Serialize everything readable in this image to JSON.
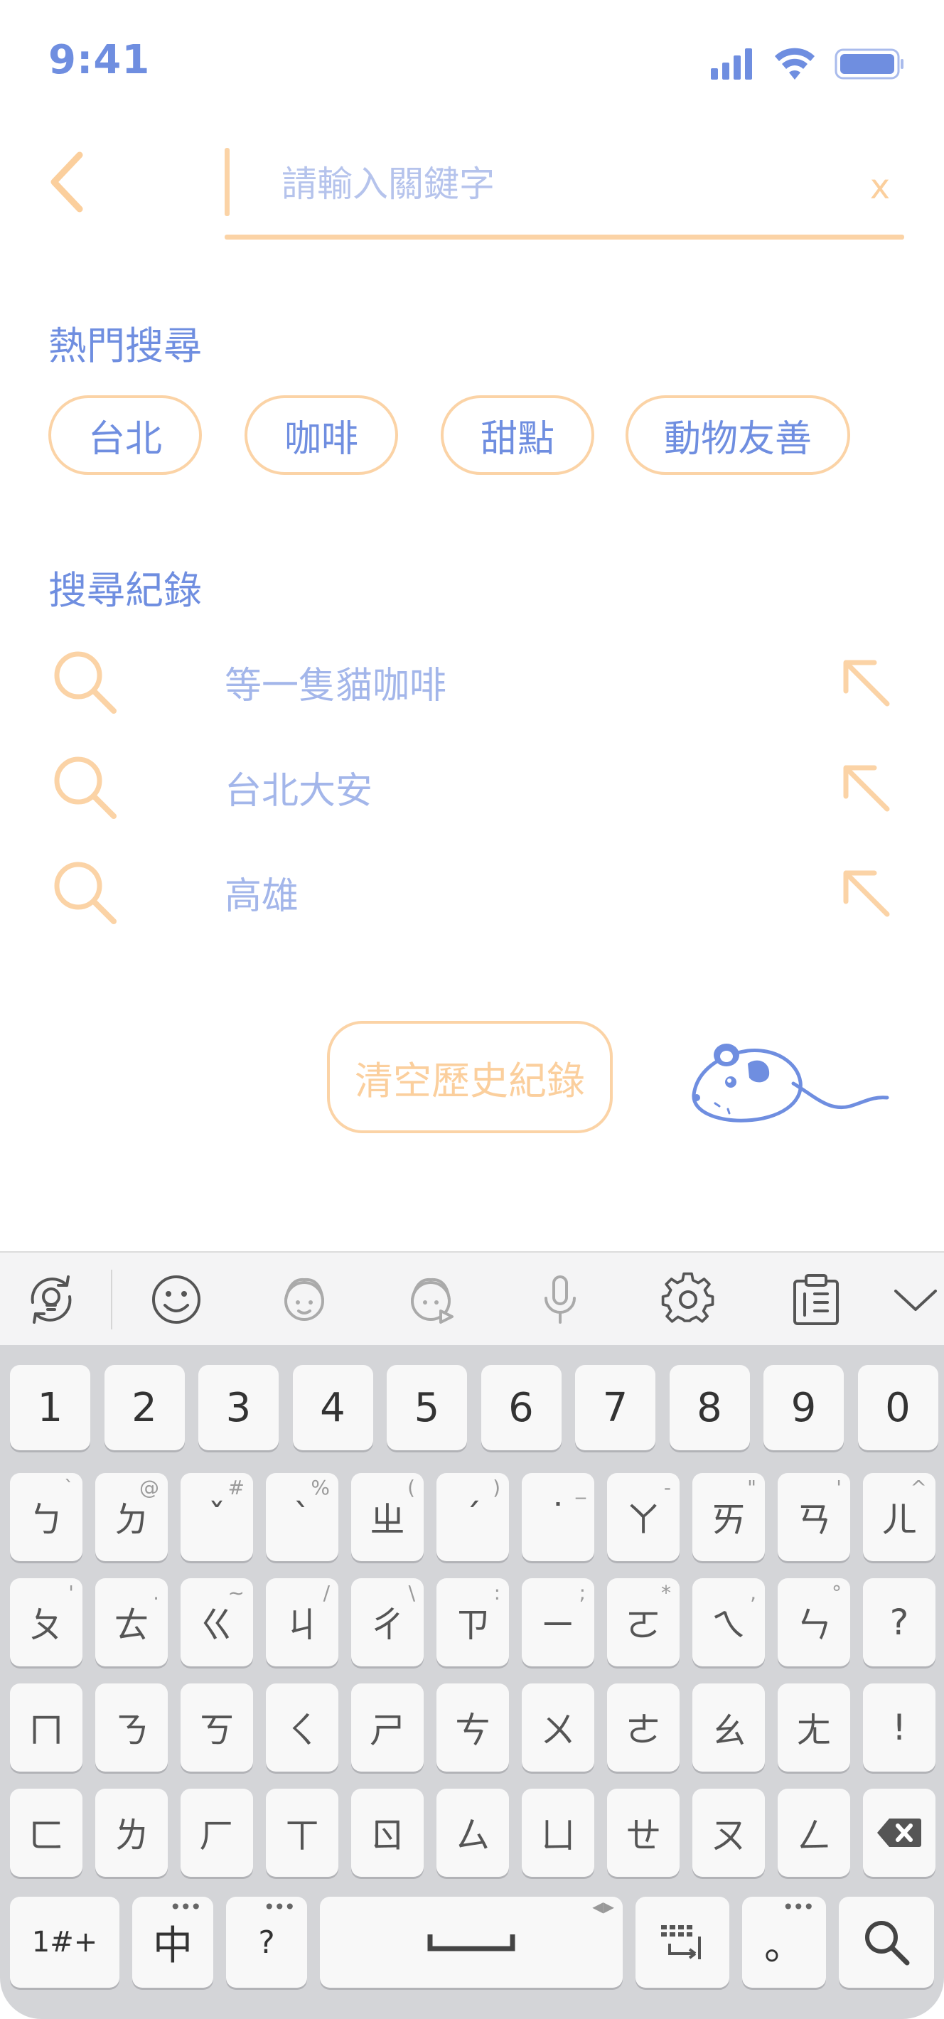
{
  "status_bar": {
    "time": "9:41"
  },
  "search": {
    "placeholder": "請輸入關鍵字",
    "value": "",
    "clear_label": "x"
  },
  "popular": {
    "title": "熱門搜尋",
    "chips": [
      "台北",
      "咖啡",
      "甜點",
      "動物友善"
    ]
  },
  "history": {
    "title": "搜尋紀錄",
    "items": [
      "等一隻貓咖啡",
      "台北大安",
      "高雄"
    ],
    "clear_label": "清空歷史紀錄"
  },
  "colors": {
    "accent_blue": "#6f8ee0",
    "light_blue": "#a3b6ea",
    "accent_orange": "#fbd3a6"
  },
  "keyboard": {
    "toolbar_icons": [
      "lightbulb-sync-icon",
      "emoji-icon",
      "face-icon",
      "face-play-icon",
      "microphone-icon",
      "gear-icon",
      "clipboard-icon",
      "chevron-down-icon"
    ],
    "numbers": [
      "1",
      "2",
      "3",
      "4",
      "5",
      "6",
      "7",
      "8",
      "9",
      "0"
    ],
    "row1": [
      {
        "k": "ㄅ",
        "s": "`"
      },
      {
        "k": "ㄉ",
        "s": "@"
      },
      {
        "k": "ˇ",
        "s": "#"
      },
      {
        "k": "ˋ",
        "s": "%"
      },
      {
        "k": "ㄓ",
        "s": "("
      },
      {
        "k": "ˊ",
        "s": ")"
      },
      {
        "k": "˙",
        "s": "_"
      },
      {
        "k": "ㄚ",
        "s": "-"
      },
      {
        "k": "ㄞ",
        "s": "\""
      },
      {
        "k": "ㄢ",
        "s": "'"
      },
      {
        "k": "ㄦ",
        "s": "^"
      }
    ],
    "row2": [
      {
        "k": "ㄆ",
        "s": "'"
      },
      {
        "k": "ㄊ",
        "s": "."
      },
      {
        "k": "ㄍ",
        "s": "~"
      },
      {
        "k": "ㄐ",
        "s": "/"
      },
      {
        "k": "ㄔ",
        "s": "\\"
      },
      {
        "k": "ㄗ",
        "s": ":"
      },
      {
        "k": "ㄧ",
        "s": ";"
      },
      {
        "k": "ㄛ",
        "s": "*"
      },
      {
        "k": "ㄟ",
        "s": ","
      },
      {
        "k": "ㄣ",
        "s": "°"
      },
      {
        "k": "?",
        "s": ""
      }
    ],
    "row3": [
      {
        "k": "ㄇ",
        "s": ""
      },
      {
        "k": "ㄋ",
        "s": ""
      },
      {
        "k": "ㄎ",
        "s": ""
      },
      {
        "k": "ㄑ",
        "s": ""
      },
      {
        "k": "ㄕ",
        "s": ""
      },
      {
        "k": "ㄘ",
        "s": ""
      },
      {
        "k": "ㄨ",
        "s": ""
      },
      {
        "k": "ㄜ",
        "s": ""
      },
      {
        "k": "ㄠ",
        "s": ""
      },
      {
        "k": "ㄤ",
        "s": ""
      },
      {
        "k": "!",
        "s": ""
      }
    ],
    "row4": [
      {
        "k": "ㄈ",
        "s": ""
      },
      {
        "k": "ㄌ",
        "s": ""
      },
      {
        "k": "ㄏ",
        "s": ""
      },
      {
        "k": "ㄒ",
        "s": ""
      },
      {
        "k": "ㄖ",
        "s": ""
      },
      {
        "k": "ㄙ",
        "s": ""
      },
      {
        "k": "ㄩ",
        "s": ""
      },
      {
        "k": "ㄝ",
        "s": ""
      },
      {
        "k": "ㄡ",
        "s": ""
      },
      {
        "k": "ㄥ",
        "s": ""
      }
    ],
    "bottom": {
      "symbols": "1#+",
      "lang": "中",
      "question": "?",
      "period": "。"
    }
  }
}
